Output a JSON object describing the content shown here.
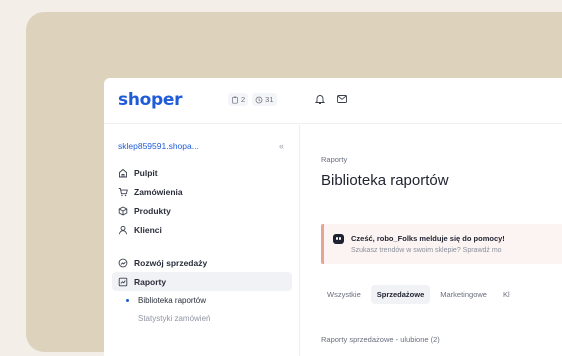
{
  "app": {
    "logo": "shoper"
  },
  "header": {
    "badges": [
      {
        "icon": "clipboard-icon",
        "count": "2"
      },
      {
        "icon": "clock-icon",
        "count": "31"
      }
    ],
    "icons": [
      "bell-icon",
      "mail-icon"
    ]
  },
  "sidebar": {
    "shop_name": "sklep859591.shopa...",
    "collapse_label": "«",
    "items": [
      {
        "label": "Pulpit",
        "icon": "home-icon"
      },
      {
        "label": "Zamówienia",
        "icon": "cart-icon"
      },
      {
        "label": "Produkty",
        "icon": "box-icon"
      },
      {
        "label": "Klienci",
        "icon": "user-icon"
      },
      {
        "label": "Rozwój sprzedaży",
        "icon": "growth-icon"
      },
      {
        "label": "Raporty",
        "icon": "chart-icon",
        "active": true
      }
    ],
    "subitems": [
      {
        "label": "Biblioteka raportów",
        "active": true
      },
      {
        "label": "Statystyki zamówień"
      }
    ]
  },
  "main": {
    "breadcrumb": "Raporty",
    "title": "Biblioteka raportów",
    "banner": {
      "title": "Cześć, robo_Folks melduje się do pomocy!",
      "text": "Szukasz trendów w swoim sklepie? Sprawdź mo"
    },
    "tabs": [
      {
        "label": "Wszystkie"
      },
      {
        "label": "Sprzedażowe",
        "active": true
      },
      {
        "label": "Marketingowe"
      },
      {
        "label": "Kl"
      }
    ],
    "section_title": "Raporty sprzedażowe - ulubione (2)"
  },
  "colors": {
    "brand": "#1f5bd8",
    "backdrop": "#ddd3bd",
    "page": "#f3efe8",
    "banner_accent": "#e7a393"
  }
}
